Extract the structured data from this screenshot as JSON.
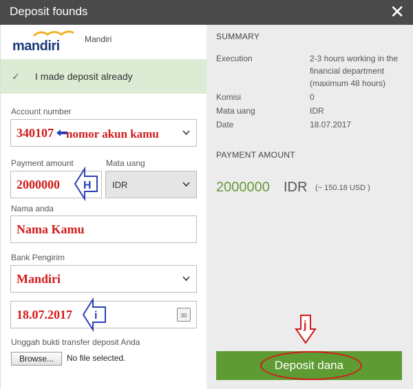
{
  "window": {
    "title": "Deposit founds",
    "close_glyph": "✕"
  },
  "bank": {
    "logo_text": "mandiri",
    "name": "Mandiri"
  },
  "deposit_check": {
    "label": "I made deposit already",
    "checked": true
  },
  "form": {
    "account": {
      "label": "Account number",
      "value": "340107",
      "annotation": "nomor akun kamu"
    },
    "amount": {
      "label": "Payment amount",
      "value": "2000000",
      "marker": "H"
    },
    "currency": {
      "label": "Mata uang",
      "value": "IDR"
    },
    "name": {
      "label": "Nama anda",
      "value": "Nama Kamu"
    },
    "bank": {
      "label": "Bank Pengirim",
      "value": "Mandiri"
    },
    "date": {
      "value": "18.07.2017",
      "marker": "i",
      "calendar_day": "30"
    },
    "upload": {
      "label": "Unggah bukti transfer deposit Anda",
      "browse_label": "Browse...",
      "status": "No file selected."
    }
  },
  "summary": {
    "heading": "SUMMARY",
    "rows": [
      {
        "key": "Execution",
        "value": "2-3 hours working in the financial department (maximum 48 hours)"
      },
      {
        "key": "Komisi",
        "value": "0"
      },
      {
        "key": "Mata uang",
        "value": "IDR"
      },
      {
        "key": "Date",
        "value": "18.07.2017"
      }
    ]
  },
  "payment": {
    "heading": "PAYMENT AMOUNT",
    "amount": "2000000",
    "currency": "IDR",
    "approx": "(~ 150.18 USD )"
  },
  "deposit_button": {
    "label": "Deposit dana",
    "marker": "j"
  },
  "colors": {
    "titlebar": "#4a4a4a",
    "accent_green": "#5e9c33",
    "amount_green": "#6a9a3a",
    "annotation_red": "#d11a1a",
    "arrow_blue": "#2a3fb8"
  }
}
